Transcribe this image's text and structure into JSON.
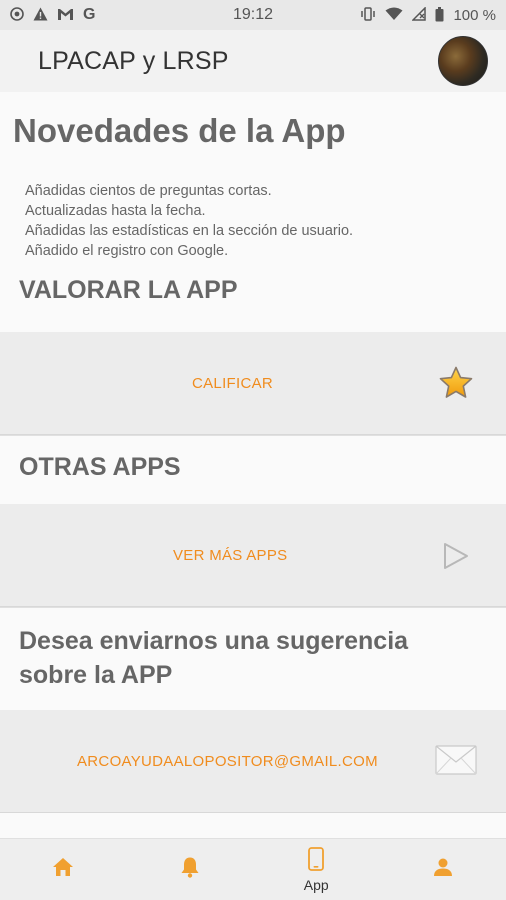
{
  "status_bar": {
    "time": "19:12",
    "battery": "100 %",
    "left_icons": [
      "radio-icon",
      "alert-icon",
      "gmail-icon",
      "google-icon"
    ],
    "right_icons": [
      "vibrate-icon",
      "wifi-icon",
      "no-signal-icon",
      "battery-icon"
    ]
  },
  "app_bar": {
    "title": "LPACAP y LRSP"
  },
  "news": {
    "title": "Novedades de la App",
    "items": [
      "Añadidas cientos de preguntas cortas.",
      "Actualizadas hasta la fecha.",
      "Añadidas las estadísticas en la sección de usuario.",
      "Añadido el registro con Google."
    ]
  },
  "rate": {
    "title": "VALORAR LA APP",
    "action_label": "CALIFICAR",
    "icon": "star-icon"
  },
  "other_apps": {
    "title": "OTRAS APPS",
    "action_label": "VER MÁS APPS",
    "icon": "play-icon"
  },
  "suggestion": {
    "title_line1": "Desea enviarnos una sugerencia",
    "title_line2": "sobre la APP",
    "action_label": "ARCOAYUDAALOPOSITOR@GMAIL.COM",
    "icon": "mail-icon"
  },
  "bottom_nav": {
    "items": [
      {
        "icon": "home-icon",
        "label": ""
      },
      {
        "icon": "bell-icon",
        "label": ""
      },
      {
        "icon": "phone-icon",
        "label": "App"
      },
      {
        "icon": "user-icon",
        "label": ""
      }
    ]
  },
  "colors": {
    "accent": "#f08c1e",
    "card": "#ececec",
    "status_bar": "#e8e8e8"
  }
}
